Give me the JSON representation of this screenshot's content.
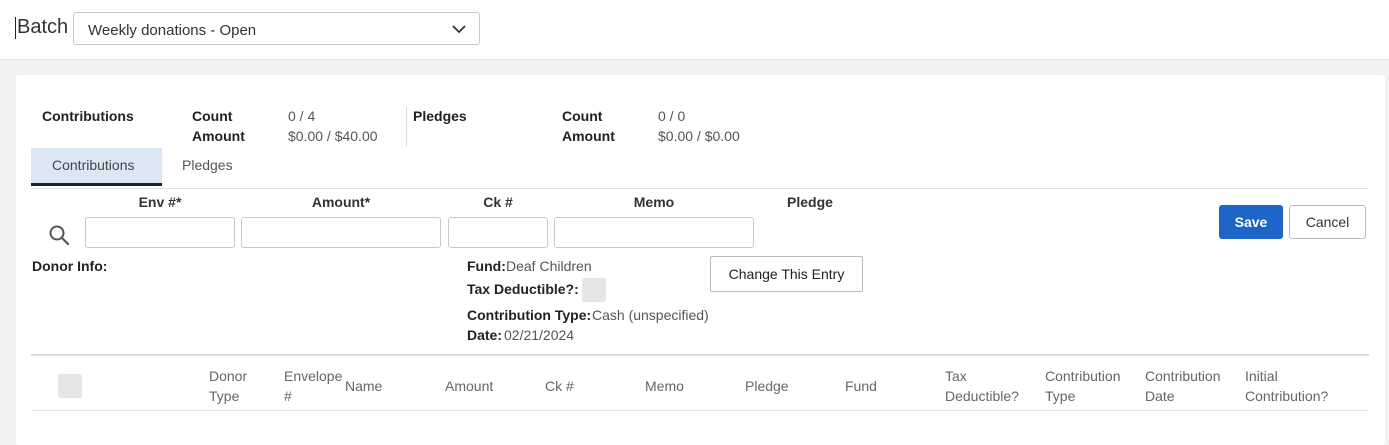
{
  "batch": {
    "label": "Batch",
    "selected": "Weekly donations - Open"
  },
  "summary": {
    "contributions": {
      "title": "Contributions",
      "count_label": "Count",
      "count": "0 / 4",
      "amount_label": "Amount",
      "amount": "$0.00 / $40.00"
    },
    "pledges": {
      "title": "Pledges",
      "count_label": "Count",
      "count": "0 / 0",
      "amount_label": "Amount",
      "amount": "$0.00 / $0.00"
    }
  },
  "tabs": [
    {
      "label": "Contributions",
      "active": true
    },
    {
      "label": "Pledges",
      "active": false
    }
  ],
  "entry_form": {
    "columns": {
      "env": "Env #*",
      "amount": "Amount*",
      "check": "Ck #",
      "memo": "Memo",
      "pledge": "Pledge"
    },
    "values": {
      "env": "",
      "amount": "",
      "check": "",
      "memo": ""
    },
    "save_label": "Save",
    "cancel_label": "Cancel"
  },
  "donor_info_label": "Donor Info:",
  "entry_details": {
    "fund_label": "Fund:",
    "fund": "Deaf Children",
    "tax_label": "Tax Deductible?:",
    "type_label": "Contribution Type:",
    "type": "Cash (unspecified)",
    "date_label": "Date:",
    "date": "02/21/2024",
    "change_button": "Change This Entry"
  },
  "table": {
    "headers": {
      "donor_type": [
        "Donor",
        "Type"
      ],
      "envelope": [
        "Envelope",
        "#"
      ],
      "name": "Name",
      "amount": "Amount",
      "check": "Ck #",
      "memo": "Memo",
      "pledge": "Pledge",
      "fund": "Fund",
      "tax": [
        "Tax",
        "Deductible?"
      ],
      "ctype": [
        "Contribution",
        "Type"
      ],
      "cdate": [
        "Contribution",
        "Date"
      ],
      "initial": [
        "Initial",
        "Contribution?"
      ]
    }
  },
  "colors": {
    "primary": "#1d66c8",
    "active_tab": "#dbe7f4"
  }
}
